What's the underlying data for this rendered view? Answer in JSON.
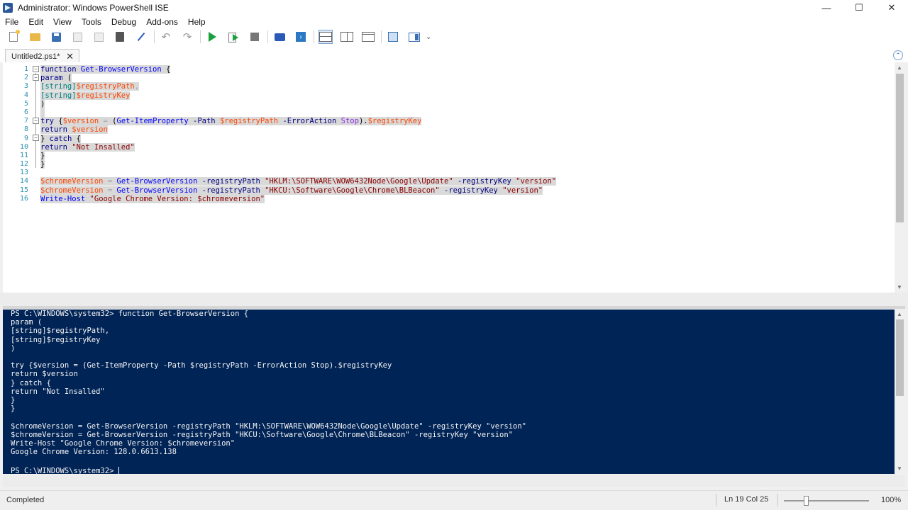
{
  "window": {
    "title": "Administrator: Windows PowerShell ISE",
    "minimize": "—",
    "maximize": "☐",
    "close": "✕"
  },
  "menu": [
    "File",
    "Edit",
    "View",
    "Tools",
    "Debug",
    "Add-ons",
    "Help"
  ],
  "toolbar": {
    "icons": [
      "new-script-icon",
      "open-icon",
      "save-icon",
      "cut-icon",
      "copy-icon",
      "paste-icon",
      "clear-console-icon",
      "undo-icon",
      "redo-icon",
      "run-script-icon",
      "run-selection-icon",
      "stop-icon",
      "remote-powershell-icon",
      "powershell-console-icon",
      "script-pane-top-icon",
      "script-pane-right-icon",
      "script-pane-maximized-icon",
      "show-command-window-icon",
      "show-command-addon-icon"
    ],
    "more": "⌄"
  },
  "tab": {
    "label": "Untitled2.ps1*",
    "close": "✕"
  },
  "editor": {
    "line_numbers": [
      "1",
      "2",
      "3",
      "4",
      "5",
      "6",
      "7",
      "8",
      "9",
      "10",
      "11",
      "12",
      "13",
      "14",
      "15",
      "16"
    ],
    "lines": [
      [
        [
          "k",
          "function"
        ],
        [
          "p",
          " "
        ],
        [
          "fn",
          "Get-BrowserVersion"
        ],
        [
          "p",
          " {"
        ]
      ],
      [
        [
          "k",
          "param"
        ],
        [
          "p",
          " ("
        ]
      ],
      [
        [
          "t",
          "[string]"
        ],
        [
          "v",
          "$registryPath"
        ],
        [
          "o",
          ","
        ]
      ],
      [
        [
          "t",
          "[string]"
        ],
        [
          "v",
          "$registryKey"
        ]
      ],
      [
        [
          "p",
          ")"
        ]
      ],
      [
        [
          "p",
          " "
        ]
      ],
      [
        [
          "k",
          "try"
        ],
        [
          "p",
          " {"
        ],
        [
          "v",
          "$version"
        ],
        [
          "p",
          " "
        ],
        [
          "o",
          "="
        ],
        [
          "p",
          " ("
        ],
        [
          "fn",
          "Get-ItemProperty"
        ],
        [
          "p",
          " "
        ],
        [
          "pm",
          "-Path"
        ],
        [
          "p",
          " "
        ],
        [
          "v",
          "$registryPath"
        ],
        [
          "p",
          " "
        ],
        [
          "pm",
          "-ErrorAction"
        ],
        [
          "p",
          " "
        ],
        [
          "c",
          "Stop"
        ],
        [
          "p",
          ")."
        ],
        [
          "v",
          "$registryKey"
        ]
      ],
      [
        [
          "k",
          "return"
        ],
        [
          "p",
          " "
        ],
        [
          "v",
          "$version"
        ]
      ],
      [
        [
          "p",
          "} "
        ],
        [
          "k",
          "catch"
        ],
        [
          "p",
          " {"
        ]
      ],
      [
        [
          "k",
          "return"
        ],
        [
          "p",
          " "
        ],
        [
          "s",
          "\"Not Insalled\""
        ]
      ],
      [
        [
          "p",
          "}"
        ]
      ],
      [
        [
          "p",
          "}"
        ]
      ],
      [],
      [
        [
          "v",
          "$chromeVersion"
        ],
        [
          "p",
          " "
        ],
        [
          "o",
          "="
        ],
        [
          "p",
          " "
        ],
        [
          "fn",
          "Get-BrowserVersion"
        ],
        [
          "p",
          " "
        ],
        [
          "pm",
          "-registryPath"
        ],
        [
          "p",
          " "
        ],
        [
          "s",
          "\"HKLM:\\SOFTWARE\\WOW6432Node\\Google\\Update\""
        ],
        [
          "p",
          " "
        ],
        [
          "pm",
          "-registryKey"
        ],
        [
          "p",
          " "
        ],
        [
          "s",
          "\"version\""
        ]
      ],
      [
        [
          "v",
          "$chromeVersion"
        ],
        [
          "p",
          " "
        ],
        [
          "o",
          "="
        ],
        [
          "p",
          " "
        ],
        [
          "fn",
          "Get-BrowserVersion"
        ],
        [
          "p",
          " "
        ],
        [
          "pm",
          "-registryPath"
        ],
        [
          "p",
          " "
        ],
        [
          "s",
          "\"HKCU:\\Software\\Google\\Chrome\\BLBeacon\""
        ],
        [
          "p",
          " "
        ],
        [
          "pm",
          "-registryKey"
        ],
        [
          "p",
          " "
        ],
        [
          "s",
          "\"version\""
        ]
      ],
      [
        [
          "fn",
          "Write-Host"
        ],
        [
          "p",
          " "
        ],
        [
          "s",
          "\"Google Chrome Version: $chromeversion\""
        ]
      ]
    ]
  },
  "console": {
    "lines": [
      "PS C:\\WINDOWS\\system32> function Get-BrowserVersion {",
      "param (",
      "[string]$registryPath,",
      "[string]$registryKey",
      ")",
      "",
      "try {$version = (Get-ItemProperty -Path $registryPath -ErrorAction Stop).$registryKey",
      "return $version",
      "} catch {",
      "return \"Not Insalled\"",
      "}",
      "}",
      "",
      "$chromeVersion = Get-BrowserVersion -registryPath \"HKLM:\\SOFTWARE\\WOW6432Node\\Google\\Update\" -registryKey \"version\"",
      "$chromeVersion = Get-BrowserVersion -registryPath \"HKCU:\\Software\\Google\\Chrome\\BLBeacon\" -registryKey \"version\"",
      "Write-Host \"Google Chrome Version: $chromeversion\"",
      "Google Chrome Version: 128.0.6613.138",
      ""
    ],
    "prompt": "PS C:\\WINDOWS\\system32> "
  },
  "status": {
    "text": "Completed",
    "position": "Ln 19  Col 25",
    "zoom": "100%",
    "zoom_level": 0.25
  }
}
